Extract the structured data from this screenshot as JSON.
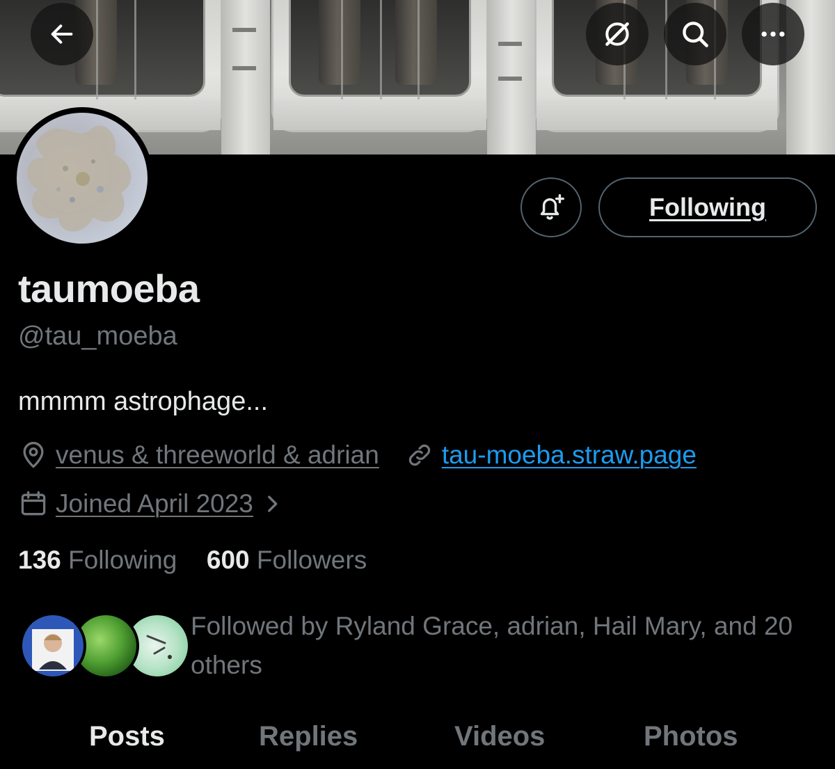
{
  "header": {
    "back_icon": "arrow-left-icon",
    "grok_icon": "grok-icon",
    "search_icon": "search-icon",
    "more_icon": "more-horizontal-icon"
  },
  "profile": {
    "display_name": "taumoeba",
    "handle": "@tau_moeba",
    "bio": "mmmm astrophage...",
    "location": "venus & threeworld & adrian",
    "website": "tau-moeba.straw.page",
    "joined": "Joined April 2023",
    "following_count": "136",
    "following_label": "Following",
    "followers_count": "600",
    "followers_label": "Followers",
    "followed_by": "Followed by Ryland Grace, adrian, Hail Mary, and 20 others"
  },
  "actions": {
    "notify_icon": "bell-plus-icon",
    "following_button": "Following"
  },
  "tabs": [
    {
      "label": "Posts",
      "active": true
    },
    {
      "label": "Replies",
      "active": false
    },
    {
      "label": "Videos",
      "active": false
    },
    {
      "label": "Photos",
      "active": false
    }
  ],
  "colors": {
    "background": "#000000",
    "primary_text": "#e7e9ea",
    "secondary_text": "#71767b",
    "link": "#1d9bf0",
    "border": "#536471"
  }
}
